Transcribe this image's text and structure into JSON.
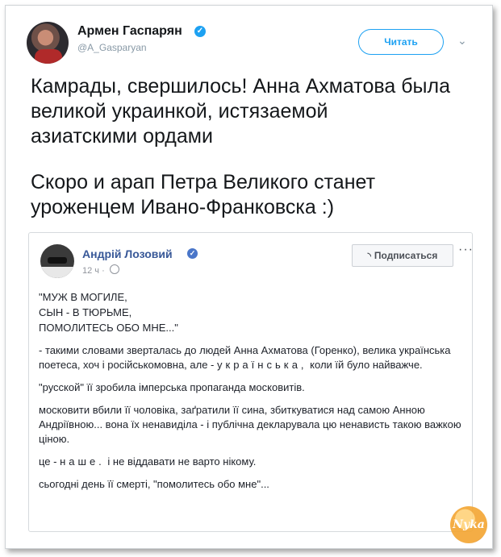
{
  "tweet": {
    "author_name": "Армен Гаспарян",
    "handle": "@A_Gasparyan",
    "follow_label": "Читать",
    "lines": [
      "Камрады, свершилось! Анна Ахматова была",
      "великой украинкой, истязаемой",
      "азиатскими ордами"
    ],
    "lines2": [
      "Скоро и арап Петра Великого станет",
      "уроженцем Ивано-Франковска :)"
    ]
  },
  "embed": {
    "author_name": "Андрій Лозовий",
    "time": "12 ч",
    "subscribe_label": "Подписаться",
    "more": "···",
    "quote_lines": [
      "\"МУЖ В МОГИЛЕ,",
      "СЫН - В ТЮРЬМЕ,",
      "ПОМОЛИТЕСЬ ОБО МНЕ...\""
    ],
    "para1": "- такими словами зверталась до людей Анна Ахматова (Горенко), велика українська поетеса, хоч і російськомовна, але -",
    "para1_spaced": "українська,",
    "para1_end": "коли їй було найважче.",
    "para2": "\"русской\" її зробила імперська пропаганда московитів.",
    "para3": "московити вбили її чоловіка, заґратили її сина, збиткуватися над самою Анною Андріївною... вона їх ненавиділа - і публічна декларувала цю ненависть такою важкою ціною.",
    "para4_start": "це -",
    "para4_spaced": "наше.",
    "para4_end": "і не віддавати не варто нікому.",
    "para5": "сьогодні день її смерті, \"помолитесь обо мне\"..."
  },
  "watermark": "Nyka",
  "icons": {
    "verified": "verified-badge-icon",
    "chevron": "chevron-down-icon",
    "rss": "rss-icon",
    "globe": "globe-icon"
  },
  "colors": {
    "twitter_blue": "#1da1f2",
    "facebook_link": "#385898",
    "watermark_orange": "#f3a531"
  }
}
